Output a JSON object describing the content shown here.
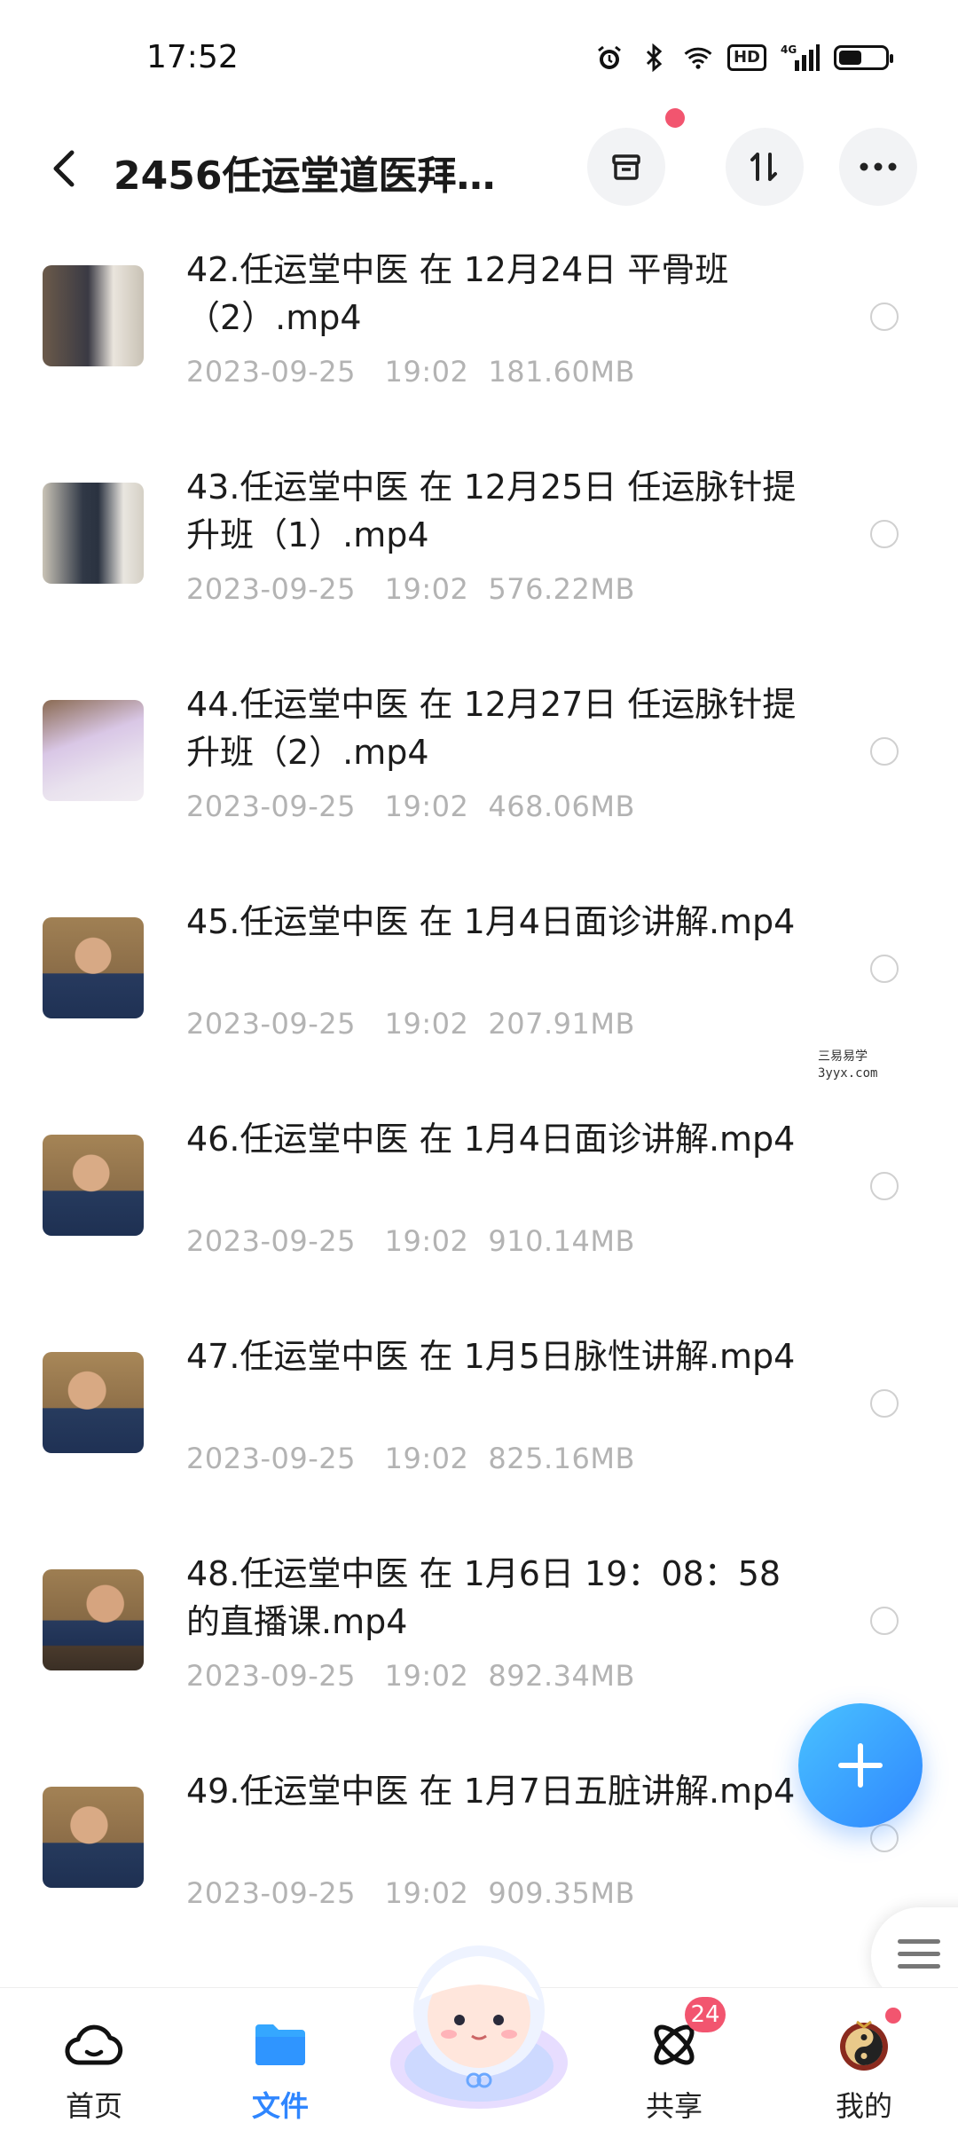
{
  "status_bar": {
    "time": "17:52",
    "network": "4G",
    "hd": "HD",
    "battery_level": 0.45
  },
  "header": {
    "title": "2456任运堂道医拜…",
    "buttons": [
      "archive-icon",
      "sort-icon",
      "more-icon"
    ]
  },
  "files": [
    {
      "name": "42.任运堂中医 在 12月24日 平骨班（2）.mp4",
      "date": "2023-09-25",
      "time": "19:02",
      "size": "181.60MB"
    },
    {
      "name": "43.任运堂中医 在 12月25日 任运脉针提升班（1）.mp4",
      "date": "2023-09-25",
      "time": "19:02",
      "size": "576.22MB"
    },
    {
      "name": "44.任运堂中医 在 12月27日 任运脉针提升班（2）.mp4",
      "date": "2023-09-25",
      "time": "19:02",
      "size": "468.06MB"
    },
    {
      "name": "45.任运堂中医 在 1月4日面诊讲解.mp4",
      "date": "2023-09-25",
      "time": "19:02",
      "size": "207.91MB"
    },
    {
      "name": "46.任运堂中医 在 1月4日面诊讲解.mp4",
      "date": "2023-09-25",
      "time": "19:02",
      "size": "910.14MB"
    },
    {
      "name": "47.任运堂中医 在 1月5日脉性讲解.mp4",
      "date": "2023-09-25",
      "time": "19:02",
      "size": "825.16MB"
    },
    {
      "name": "48.任运堂中医 在 1月6日 19：08：58的直播课.mp4",
      "date": "2023-09-25",
      "time": "19:02",
      "size": "892.34MB"
    },
    {
      "name": "49.任运堂中医 在 1月7日五脏讲解.mp4",
      "date": "2023-09-25",
      "time": "19:02",
      "size": "909.35MB"
    }
  ],
  "watermark": {
    "line1": "三易易学",
    "line2": "3yyx.com"
  },
  "bottom_nav": [
    {
      "label": "首页",
      "icon": "cloud-home-icon",
      "active": false
    },
    {
      "label": "文件",
      "icon": "folder-icon",
      "active": true
    },
    {
      "label": "",
      "icon": "mascot-icon",
      "active": false
    },
    {
      "label": "共享",
      "icon": "share-orbit-icon",
      "active": false,
      "badge": "24"
    },
    {
      "label": "我的",
      "icon": "avatar-icon",
      "active": false
    }
  ],
  "colors": {
    "accent": "#2f86ff",
    "badge": "#f2556f",
    "meta": "#b3b3b3"
  }
}
